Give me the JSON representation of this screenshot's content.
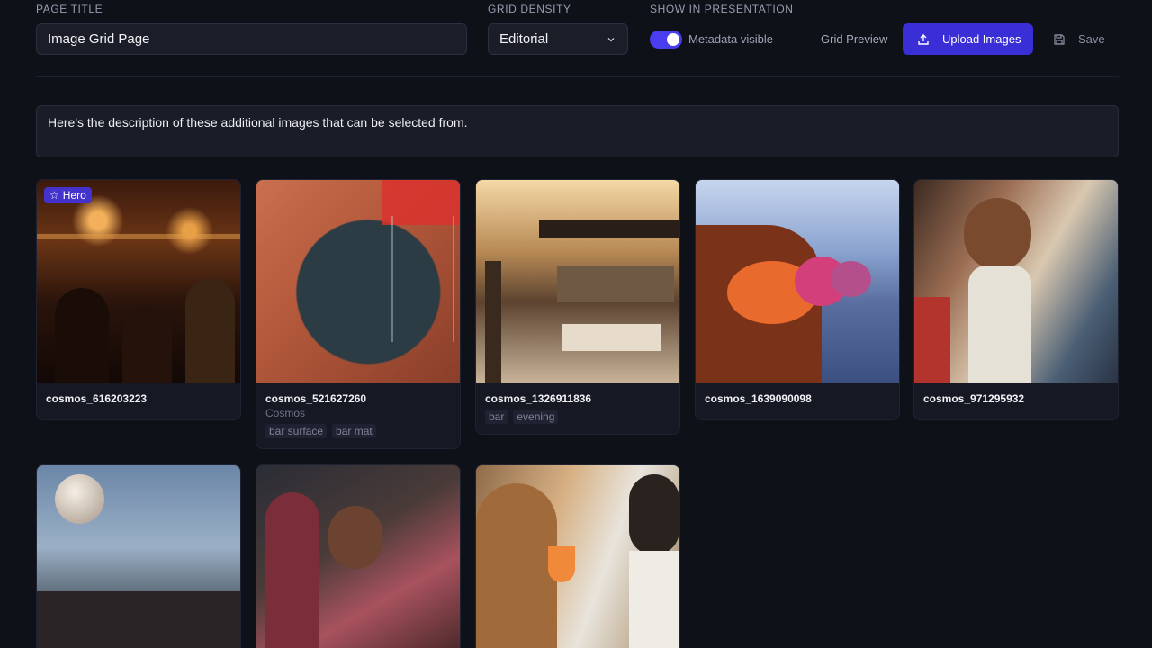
{
  "header": {
    "page_title_label": "PAGE TITLE",
    "page_title_value": "Image Grid Page",
    "grid_density_label": "GRID DENSITY",
    "grid_density_value": "Editorial",
    "presentation_label": "SHOW IN PRESENTATION",
    "metadata_toggle_label": "Metadata visible",
    "metadata_toggle_on": true,
    "grid_preview_label": "Grid Preview",
    "upload_label": "Upload Images",
    "save_label": "Save"
  },
  "description": "Here's the description of these additional images that can be selected from.",
  "colors": {
    "accent": "#3a2ed6",
    "toggle_on": "#4a3df0",
    "background": "#0f1119",
    "card": "#161924"
  },
  "images": [
    {
      "name": "cosmos_616203223",
      "badge": "Hero",
      "badge_icon": "star-icon",
      "source": "",
      "tags": []
    },
    {
      "name": "cosmos_521627260",
      "badge": "",
      "source": "Cosmos",
      "tags": [
        "bar surface",
        "bar mat"
      ]
    },
    {
      "name": "cosmos_1326911836",
      "badge": "",
      "source": "",
      "tags": [
        "bar",
        "evening"
      ]
    },
    {
      "name": "cosmos_1639090098",
      "badge": "",
      "source": "",
      "tags": []
    },
    {
      "name": "cosmos_971295932",
      "badge": "",
      "source": "",
      "tags": []
    },
    {
      "name": "",
      "badge": "",
      "source": "",
      "tags": []
    },
    {
      "name": "",
      "badge": "",
      "source": "",
      "tags": []
    },
    {
      "name": "",
      "badge": "",
      "source": "",
      "tags": []
    }
  ]
}
